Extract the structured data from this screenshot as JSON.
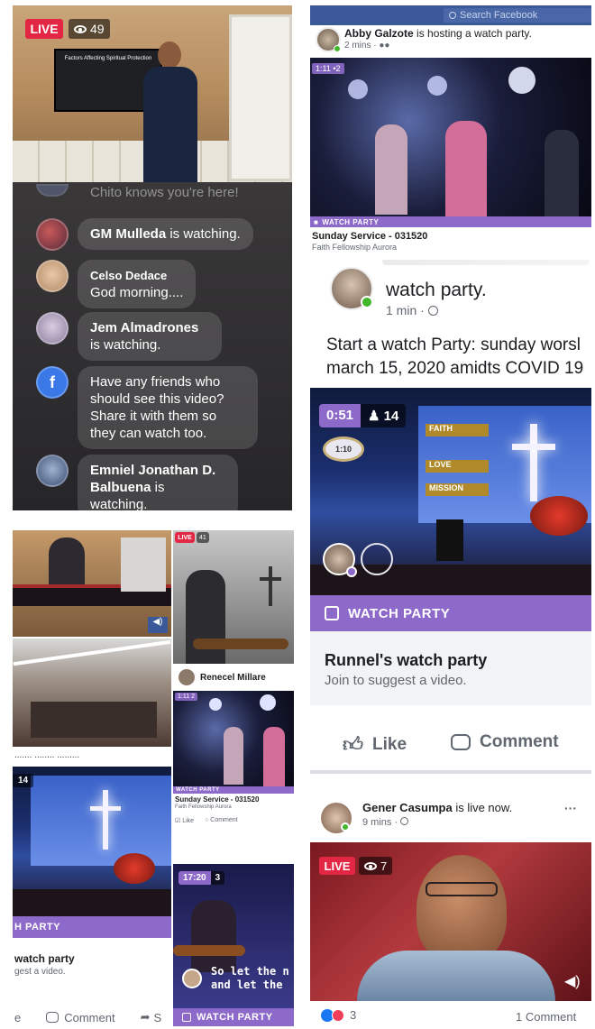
{
  "top_left_live": {
    "live_label": "LIVE",
    "viewers": "49",
    "tv_screen_text": "Factors Affecting Spiritual Protection",
    "chat": [
      {
        "name": "",
        "text": "Chito knows you're here!"
      },
      {
        "name": "GM Mulleda",
        "text": " is watching."
      },
      {
        "name": "Celso Dedace",
        "text": "God morning...."
      },
      {
        "name": "Jem Almadrones",
        "text": " is watching."
      },
      {
        "name": "",
        "text": "Have any friends who should see this video? Share it with them so they can watch too."
      },
      {
        "name": "Emniel Jonathan D. Balbuena",
        "text": " is watching."
      }
    ]
  },
  "top_right_post": {
    "search_placeholder": "Search Facebook",
    "host_name": "Abby Galzote",
    "host_action": " is hosting a watch party.",
    "time": "2 mins · ",
    "video_time": "1:11",
    "video_viewers": "2",
    "wp_label": "WATCH PARTY",
    "video_title": "Sunday Service - 031520",
    "video_channel": "Faith Fellowship Aurora"
  },
  "right_main": {
    "header_partial": "watch party.",
    "time": "1 min · ",
    "post_text_line1": "Start a watch Party: sunday worsl",
    "post_text_line2": "march 15, 2020 amidts COVID 19",
    "video_time": "0:51",
    "video_viewers": "14",
    "clock_text": "1:10",
    "banner_words": [
      "FAITH",
      "LOVE",
      "MISSION"
    ],
    "wp_label": "WATCH PARTY",
    "party_title": "Runnel's watch party",
    "party_sub": "Join to suggest a video.",
    "like_label": "Like",
    "comment_label": "Comment"
  },
  "right_bottom_post": {
    "name": "Gener Casumpa",
    "action": " is live now.",
    "time": "9 mins · ",
    "more": "···",
    "live_label": "LIVE",
    "viewers": "7",
    "reactions_count": "3",
    "comments_count": "1 Comment"
  },
  "bottom_left_collage": {
    "live_label": "LIVE",
    "viewers": "41",
    "user_name": "Renecel Millare",
    "mini_time": "1:11",
    "mini_viewers": "2",
    "mini_wp": "WATCH PARTY",
    "mini_title": "Sunday Service - 031520",
    "mini_channel": "Faith Fellowship Aurora",
    "mini_like": "Like",
    "mini_comment": "Comment",
    "left_badge": "14",
    "left_wp": "H PARTY",
    "left_title": "watch party",
    "left_sub": "gest a video.",
    "overlap_text": "....... ........ .........",
    "small_time": "17:20",
    "small_viewers": "3",
    "caption_line1": "So let the n",
    "caption_line2": "and let the",
    "small_wp": "WATCH PARTY",
    "bottom_e": "e",
    "bottom_comment": "Comment",
    "bottom_share": "S"
  }
}
